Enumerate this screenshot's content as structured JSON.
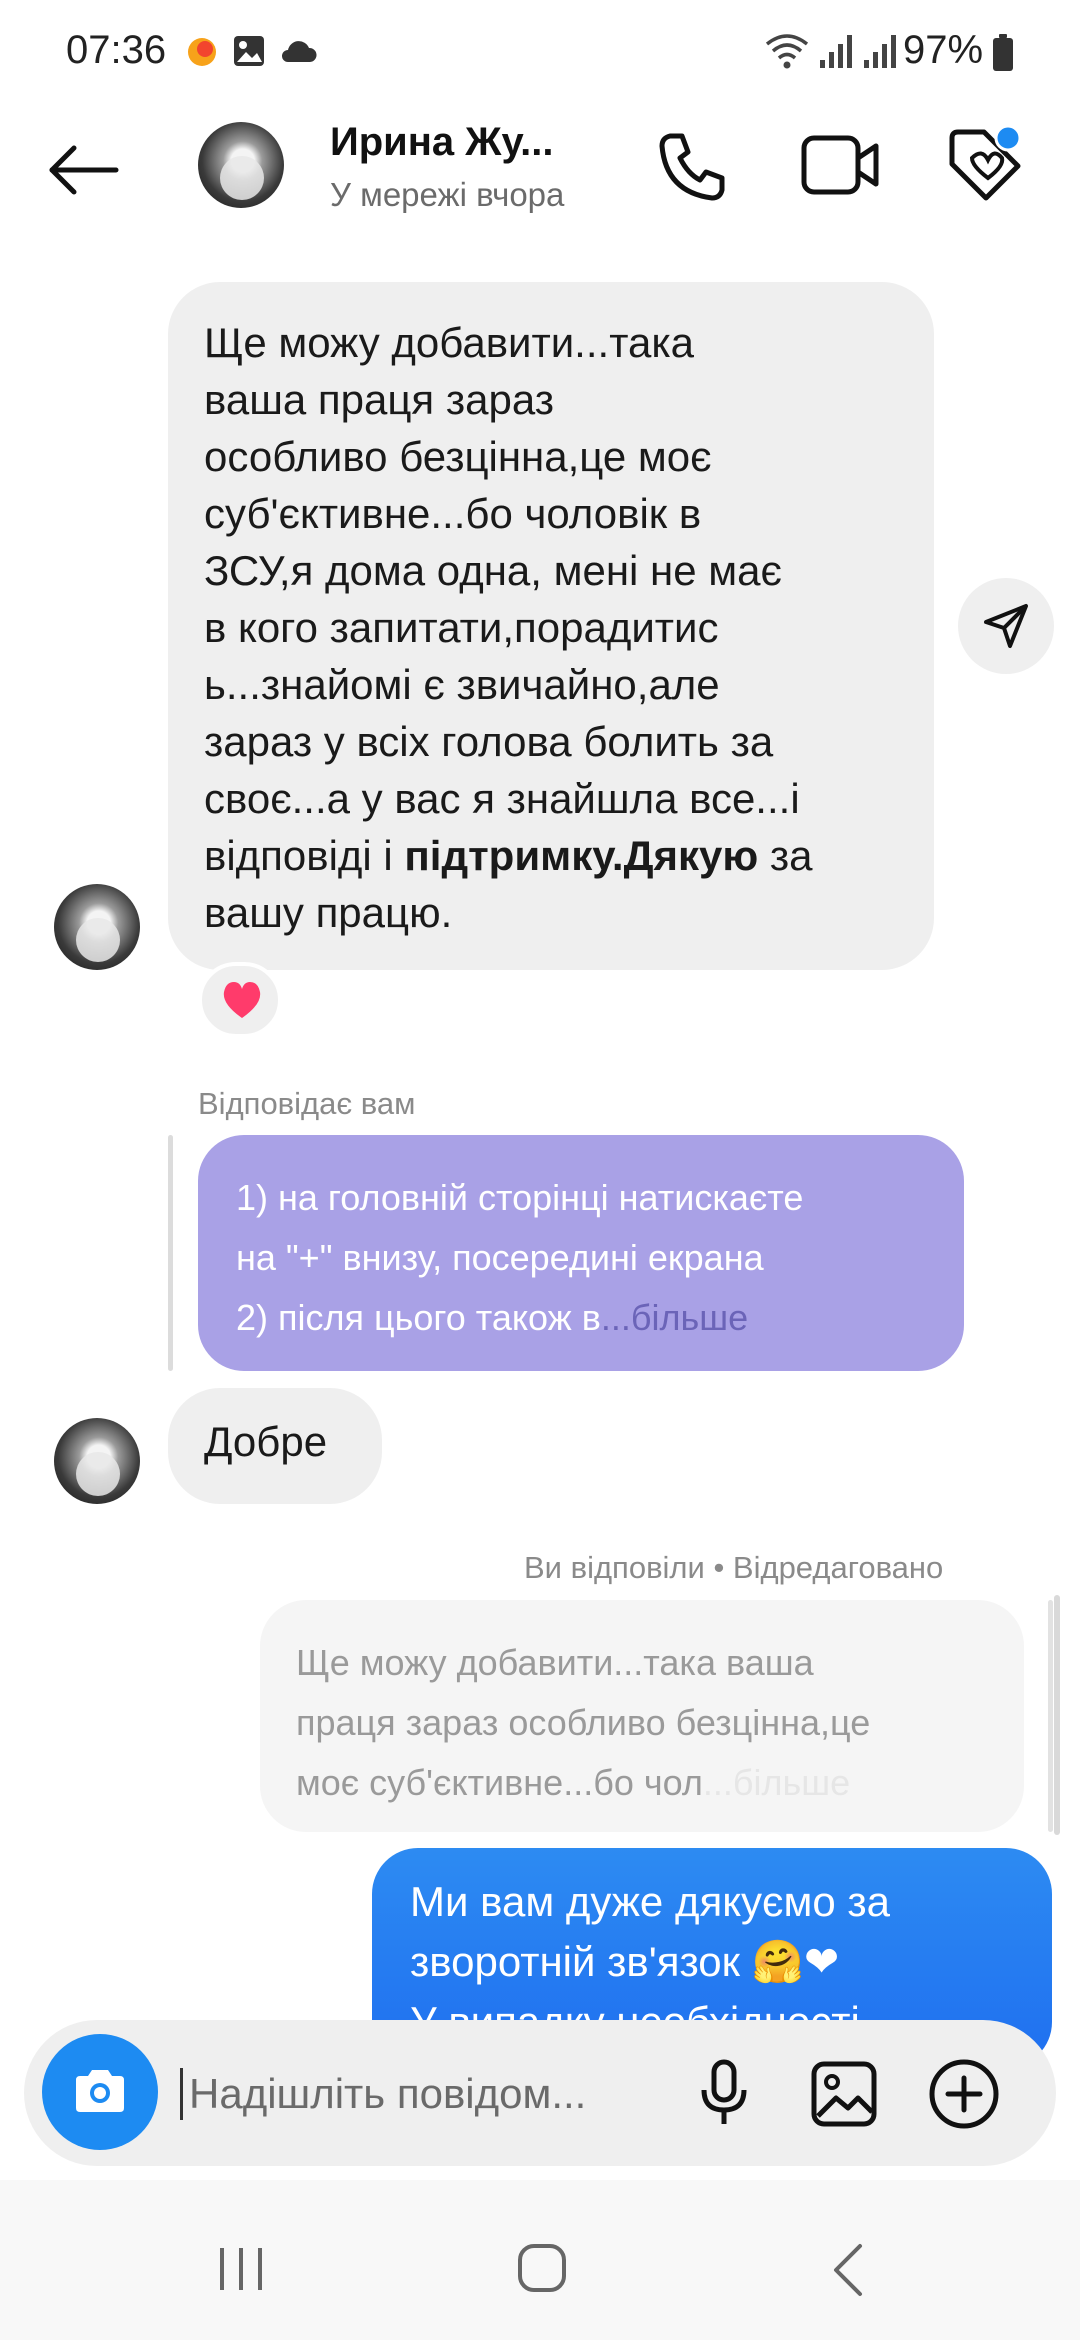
{
  "status_bar": {
    "time": "07:36",
    "battery_percent": "97%",
    "icons": [
      "notification-dot-icon",
      "gallery-icon",
      "cloud-icon",
      "wifi-icon",
      "signal-icon",
      "signal-icon",
      "battery-icon"
    ]
  },
  "header": {
    "contact_name": "Ирина Жу...",
    "contact_status": "У мережі вчора",
    "actions": [
      "back-arrow-icon",
      "phone-icon",
      "video-camera-icon",
      "tag-icon"
    ]
  },
  "messages": {
    "incoming_1": {
      "line1": "Ще можу добавити...така",
      "line2": "ваша праця зараз",
      "line3": "особливо безцінна,це моє",
      "line4": "суб'єктивне...бо чоловік в",
      "line5": "ЗСУ,я дома одна, мені не має",
      "line6": "в кого запитати,порадитис",
      "line7": "ь...знайомі є звичайно,але",
      "line8": "зараз у всіх голова болить за",
      "line9": "своє...а у вас я знайшла все...і",
      "line10_a": "відповіді і ",
      "line10_bold": "підтримку.Дякую",
      "line10_b": " за",
      "line11": "вашу працю.",
      "reaction": "❤"
    },
    "reply_to_you": {
      "label": "Відповідає вам",
      "quote_line1": "1) на головній сторінці натискаєте",
      "quote_line2": "на \"+\" внизу, посередині екрана",
      "quote_line3": "2) після цього також в",
      "quote_more": "...більше"
    },
    "incoming_2": {
      "text": "Добре"
    },
    "you_replied": {
      "label": "Ви відповіли • Відредаговано",
      "quote_line1": "Ще можу добавити...така ваша",
      "quote_line2": "праця зараз особливо безцінна,це",
      "quote_line3": "моє суб'єктивне...бо чол",
      "quote_more": "...більше"
    },
    "outgoing_1": {
      "line1": "Ми вам дуже дякуємо за",
      "line2": "зворотній зв'язок 🤗❤",
      "line3": "У випадку необхідності"
    }
  },
  "composer": {
    "placeholder": "Надішліть повідом...",
    "icons": [
      "camera-icon",
      "microphone-icon",
      "image-icon",
      "add-circle-icon"
    ]
  },
  "system_nav": {
    "icons": [
      "recent-apps-icon",
      "home-icon",
      "back-icon"
    ]
  },
  "colors": {
    "accent_blue": "#1d8bf2",
    "outgoing_bubble": "#2d8bf2",
    "incoming_bubble": "#efefef",
    "quote_purple": "#a9a1e6"
  }
}
